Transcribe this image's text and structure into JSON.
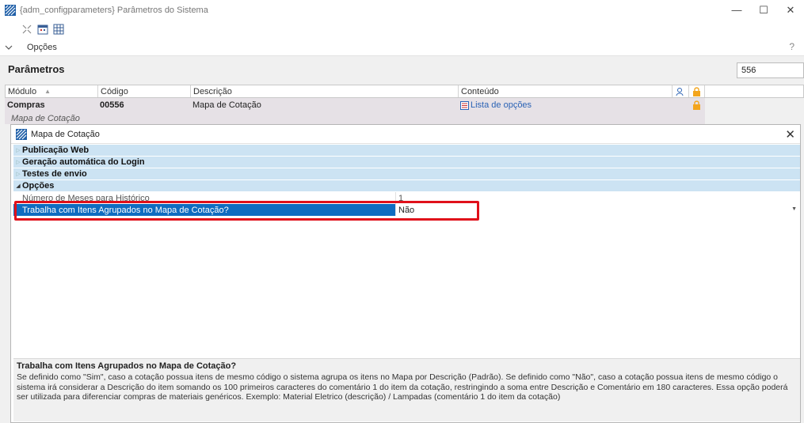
{
  "window": {
    "title": "{adm_configparameters} Parâmetros do Sistema",
    "minimize": "—",
    "maximize": "☐",
    "close": "✕"
  },
  "optbar": {
    "label": "Opções",
    "help": "?"
  },
  "params": {
    "title": "Parâmetros",
    "search_value": "556",
    "columns": [
      "Módulo",
      "Código",
      "Descrição",
      "Conteúdo"
    ],
    "row": {
      "module": "Compras",
      "code": "00556",
      "description": "Mapa de Cotação",
      "content": "Lista de opções",
      "sub": "Mapa de Cotação"
    }
  },
  "dialog": {
    "title": "Mapa de Cotação",
    "categories": [
      {
        "label": "Publicação Web",
        "expanded": false
      },
      {
        "label": "Geração automática do Login",
        "expanded": false
      },
      {
        "label": "Testes de envio",
        "expanded": false
      },
      {
        "label": "Opções",
        "expanded": true
      }
    ],
    "properties": [
      {
        "name": "Número de Meses para Histórico",
        "value": "1"
      },
      {
        "name": "Trabalha com Itens Agrupados no Mapa de Cotação?",
        "value": "Não"
      }
    ],
    "description": {
      "title": "Trabalha com Itens Agrupados no Mapa de Cotação?",
      "body": "Se definido como \"Sim\", caso a cotação possua itens de mesmo código o sistema agrupa os itens no Mapa por Descrição (Padrão). Se definido como \"Não\", caso a cotação possua itens de mesmo código o sistema irá considerar a Descrição do item somando os 100 primeiros caracteres do comentário 1 do item da cotação, restringindo a soma entre Descrição e Comentário em 180 caracteres. Essa opção poderá ser utilizada para diferenciar compras de materiais genéricos. Exemplo: Material Eletrico (descrição) / Lampadas (comentário 1 do item da cotação)"
    }
  },
  "colors": {
    "accent": "#0f6cc0",
    "category_bg": "#cce3f3",
    "highlight": "#e0101a",
    "link": "#2b63b5"
  }
}
